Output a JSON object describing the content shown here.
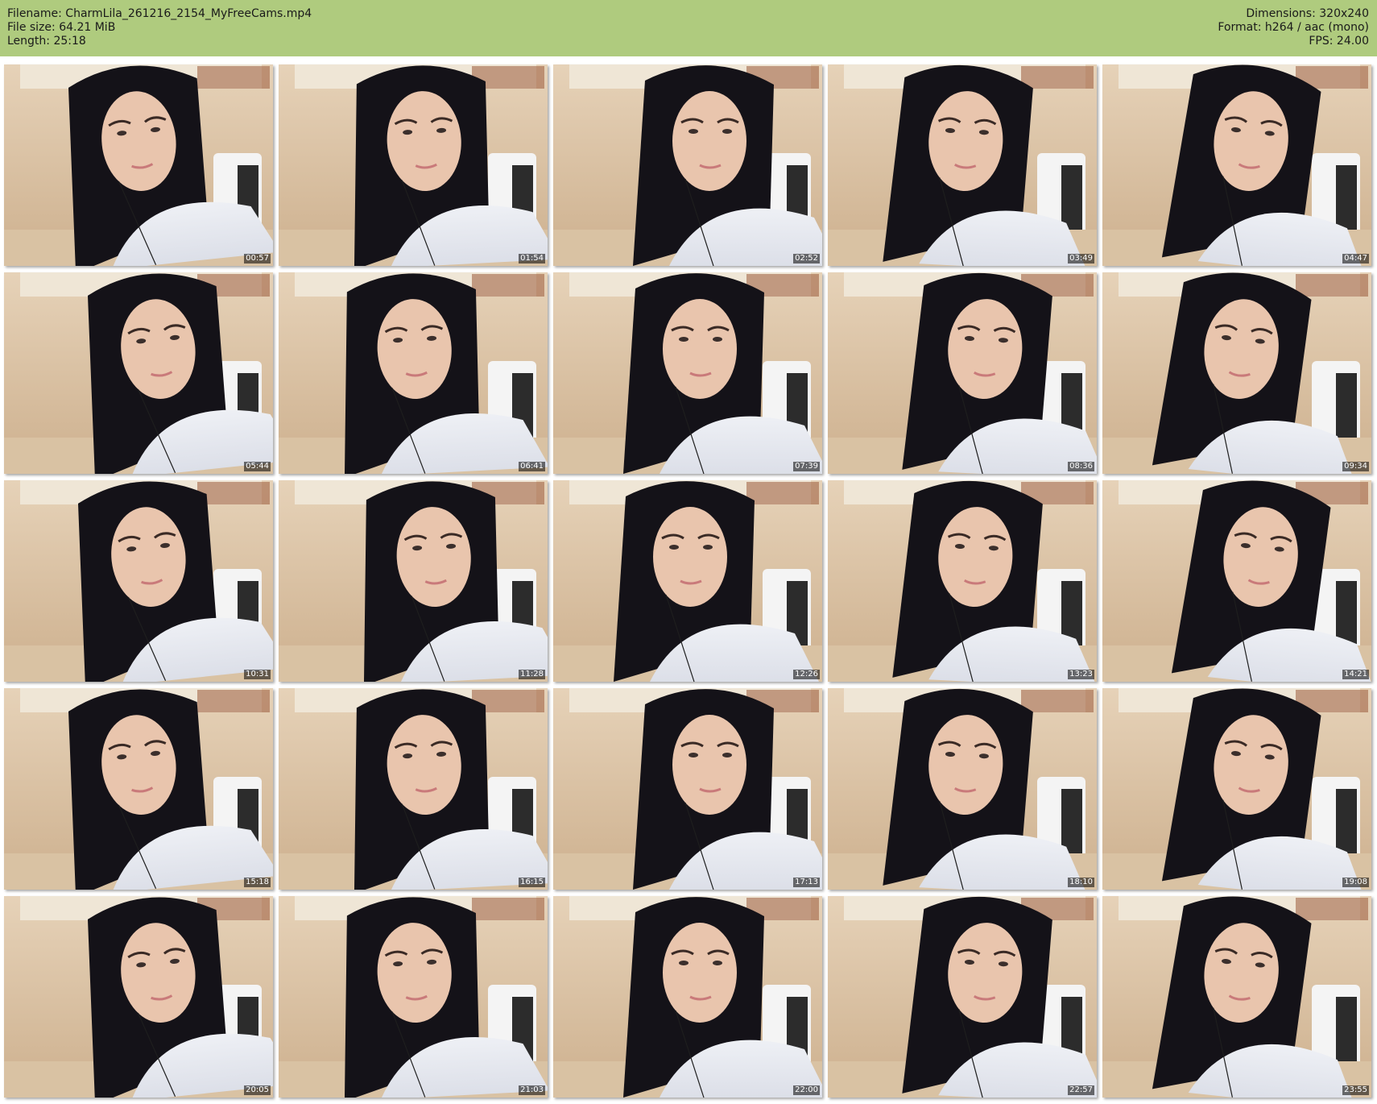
{
  "header": {
    "filename": "Filename: CharmLila_261216_2154_MyFreeCams.mp4",
    "filesize": "File size: 64.21 MiB",
    "length": "Length: 25:18",
    "dimensions": "Dimensions: 320x240",
    "format": "Format: h264 / aac (mono)",
    "fps": "FPS: 24.00",
    "background_color": "#afcb7e"
  },
  "thumbnails": [
    {
      "timestamp": "00:57"
    },
    {
      "timestamp": "01:54"
    },
    {
      "timestamp": "02:52"
    },
    {
      "timestamp": "03:49"
    },
    {
      "timestamp": "04:47"
    },
    {
      "timestamp": "05:44"
    },
    {
      "timestamp": "06:41"
    },
    {
      "timestamp": "07:39"
    },
    {
      "timestamp": "08:36"
    },
    {
      "timestamp": "09:34"
    },
    {
      "timestamp": "10:31"
    },
    {
      "timestamp": "11:28"
    },
    {
      "timestamp": "12:26"
    },
    {
      "timestamp": "13:23"
    },
    {
      "timestamp": "14:21"
    },
    {
      "timestamp": "15:18"
    },
    {
      "timestamp": "16:15"
    },
    {
      "timestamp": "17:13"
    },
    {
      "timestamp": "18:10"
    },
    {
      "timestamp": "19:08"
    },
    {
      "timestamp": "20:05"
    },
    {
      "timestamp": "21:03"
    },
    {
      "timestamp": "22:00"
    },
    {
      "timestamp": "22:57"
    },
    {
      "timestamp": "23:55"
    }
  ]
}
